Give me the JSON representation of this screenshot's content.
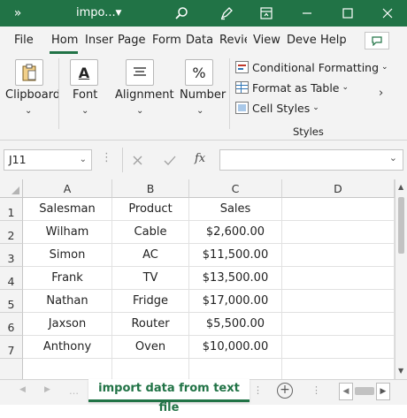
{
  "title_bar": {
    "file_name": "impo...",
    "colors": {
      "background": "#217346",
      "foreground": "#ffffff"
    },
    "icons": [
      "more-commands-icon",
      "dropdown-icon",
      "search-icon",
      "pen-icon",
      "restore-ribbon-icon",
      "minimize-icon",
      "maximize-icon",
      "close-icon"
    ]
  },
  "ribbon_tabs": [
    {
      "label": "File"
    },
    {
      "label": "Hom",
      "active": true
    },
    {
      "label": "Inser"
    },
    {
      "label": "Page"
    },
    {
      "label": "Form"
    },
    {
      "label": "Data"
    },
    {
      "label": "Revie"
    },
    {
      "label": "View"
    },
    {
      "label": "Deve"
    },
    {
      "label": "Help"
    }
  ],
  "ribbon": {
    "clipboard": "Clipboard",
    "font": "Font",
    "alignment": "Alignment",
    "number": "Number",
    "number_symbol": "%",
    "font_symbol": "A",
    "styles": {
      "conditional": "Conditional Formatting",
      "format_table": "Format as Table",
      "cell_styles": "Cell Styles",
      "group_label": "Styles"
    }
  },
  "formula_bar": {
    "name_box": "J11",
    "fx_label": "fx",
    "formula_value": ""
  },
  "sheet": {
    "column_headers": [
      "A",
      "B",
      "C",
      "D"
    ],
    "row_headers": [
      "1",
      "2",
      "3",
      "4",
      "5",
      "6",
      "7"
    ],
    "rows": [
      [
        "Salesman",
        "Product",
        "Sales"
      ],
      [
        "Wilham",
        "Cable",
        "$2,600.00"
      ],
      [
        "Simon",
        "AC",
        "$11,500.00"
      ],
      [
        "Frank",
        "TV",
        "$13,500.00"
      ],
      [
        "Nathan",
        "Fridge",
        "$17,000.00"
      ],
      [
        "Jaxson",
        "Router",
        "$5,500.00"
      ],
      [
        "Anthony",
        "Oven",
        "$10,000.00"
      ]
    ]
  },
  "sheet_tab": {
    "name": "import data from text file",
    "accent": "#217346"
  }
}
